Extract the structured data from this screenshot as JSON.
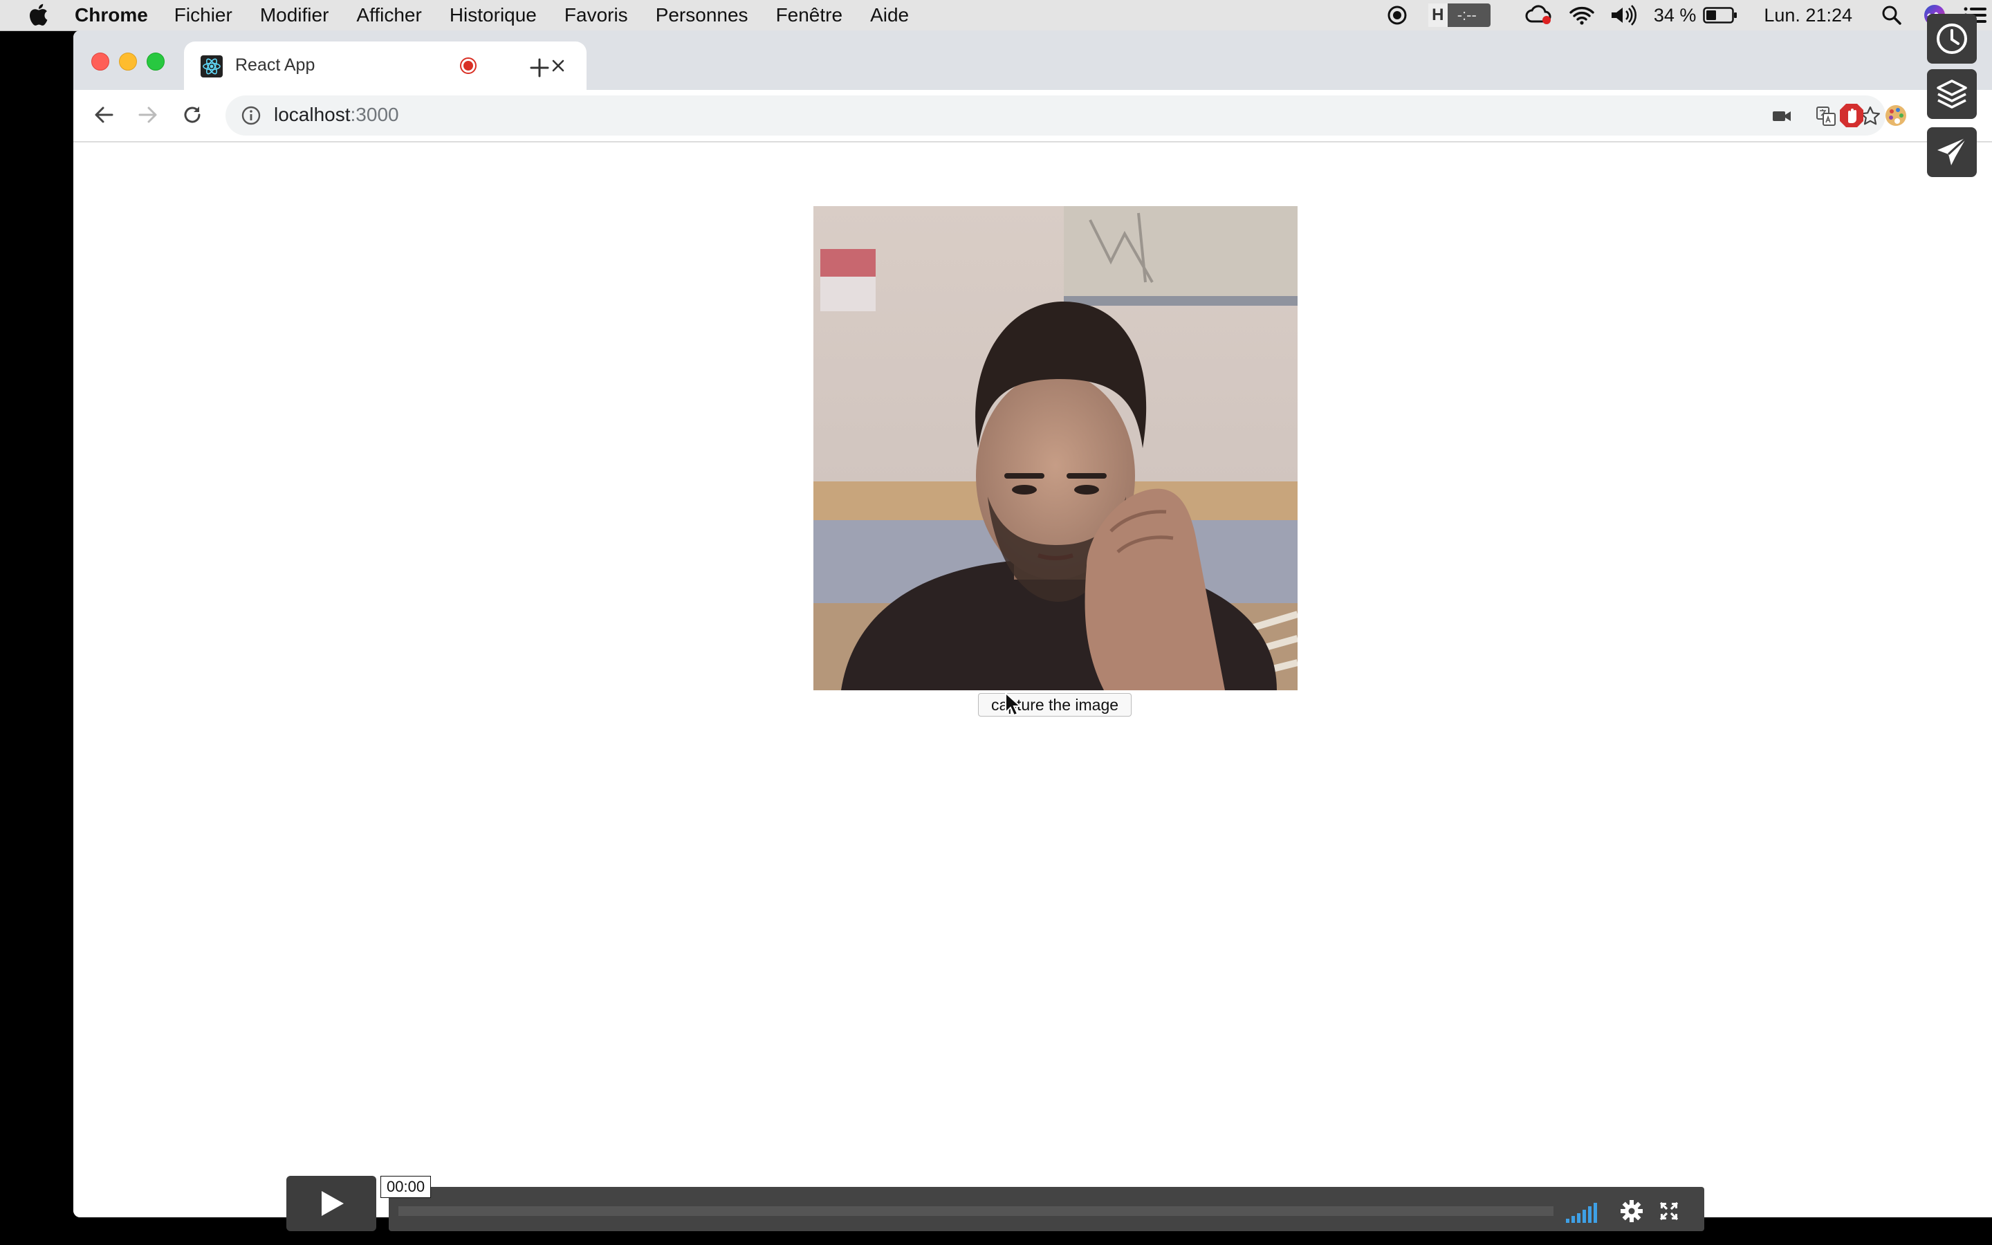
{
  "menubar": {
    "items": [
      "Chrome",
      "Fichier",
      "Modifier",
      "Afficher",
      "Historique",
      "Favoris",
      "Personnes",
      "Fenêtre",
      "Aide"
    ],
    "record_timer": "-:--",
    "battery": "34 %",
    "clock": "Lun. 21:24"
  },
  "browser": {
    "tab_title": "React App",
    "url_host": "localhost",
    "url_port": ":3000"
  },
  "page": {
    "capture_button": "capture the image"
  },
  "player": {
    "time": "00:00",
    "progress": 0
  }
}
